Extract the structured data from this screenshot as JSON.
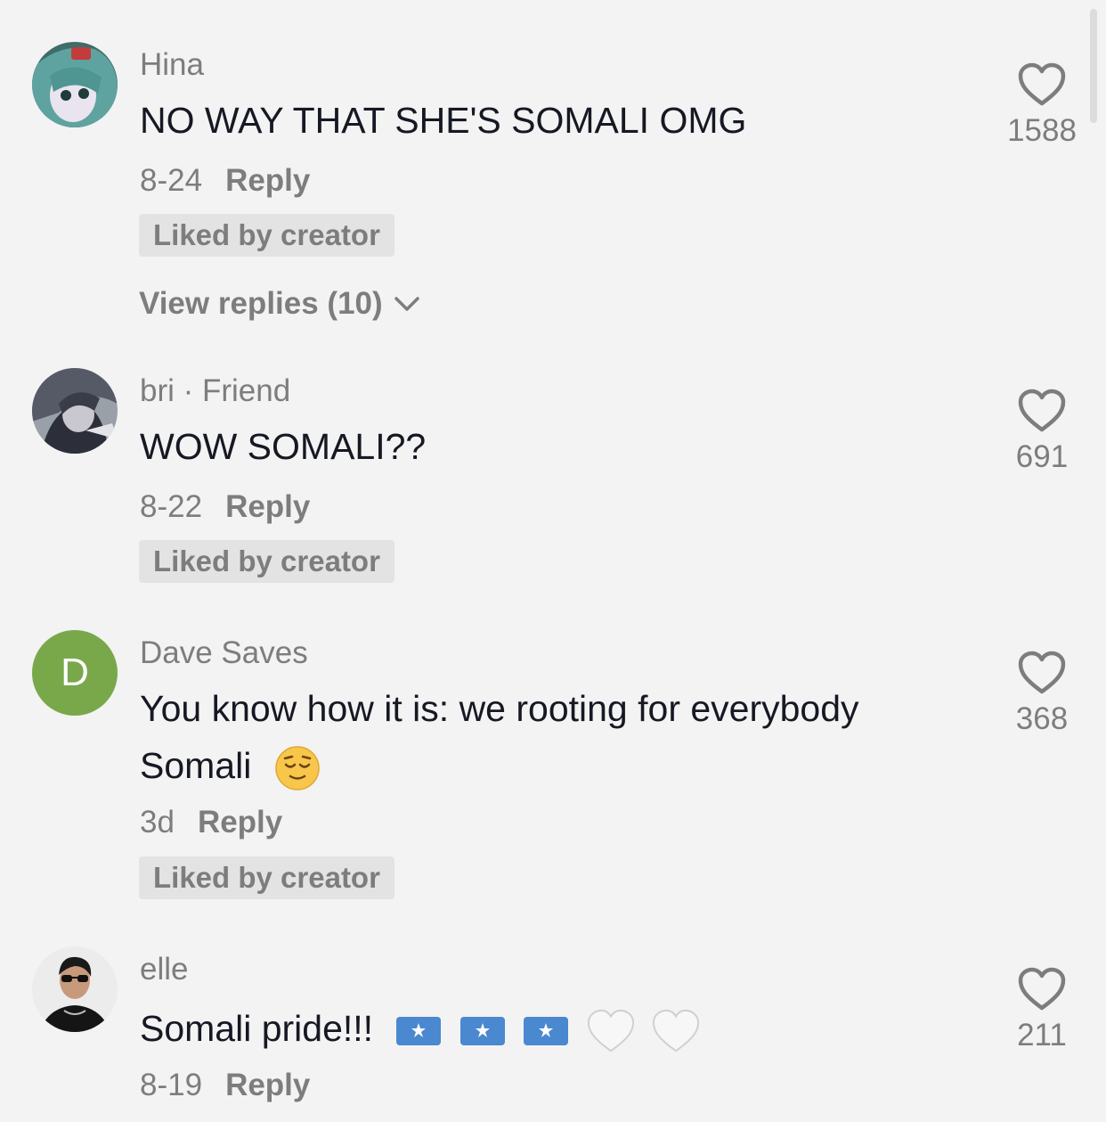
{
  "comments": [
    {
      "username": "Hina",
      "text": "NO WAY THAT SHE'S SOMALI OMG",
      "date": "8-24",
      "reply_label": "Reply",
      "badge": "Liked by creator",
      "view_replies": "View replies (10)",
      "likes": "1588",
      "avatar": "anime-avatar"
    },
    {
      "username": "bri · Friend",
      "text": "WOW SOMALI??",
      "date": "8-22",
      "reply_label": "Reply",
      "badge": "Liked by creator",
      "likes": "691",
      "avatar": "anime-avatar"
    },
    {
      "username": "Dave Saves",
      "text_line1": "You know how it is: we rooting for everybody",
      "text_line2": "Somali",
      "date": "3d",
      "reply_label": "Reply",
      "badge": "Liked by creator",
      "likes": "368",
      "avatar_letter": "D",
      "avatar_color": "#79a84a",
      "emoji": "relieved-face-emoji"
    },
    {
      "username": "elle",
      "text": "Somali pride!!!",
      "date": "8-19",
      "reply_label": "Reply",
      "likes": "211",
      "avatar": "photo-avatar",
      "emojis": [
        "somalia-flag-emoji",
        "somalia-flag-emoji",
        "somalia-flag-emoji",
        "white-heart-emoji",
        "white-heart-emoji"
      ]
    }
  ],
  "colors": {
    "background": "#f3f3f3",
    "primary_text": "#161823",
    "secondary_text": "#7d7d7d",
    "badge_bg": "#e3e3e3"
  }
}
